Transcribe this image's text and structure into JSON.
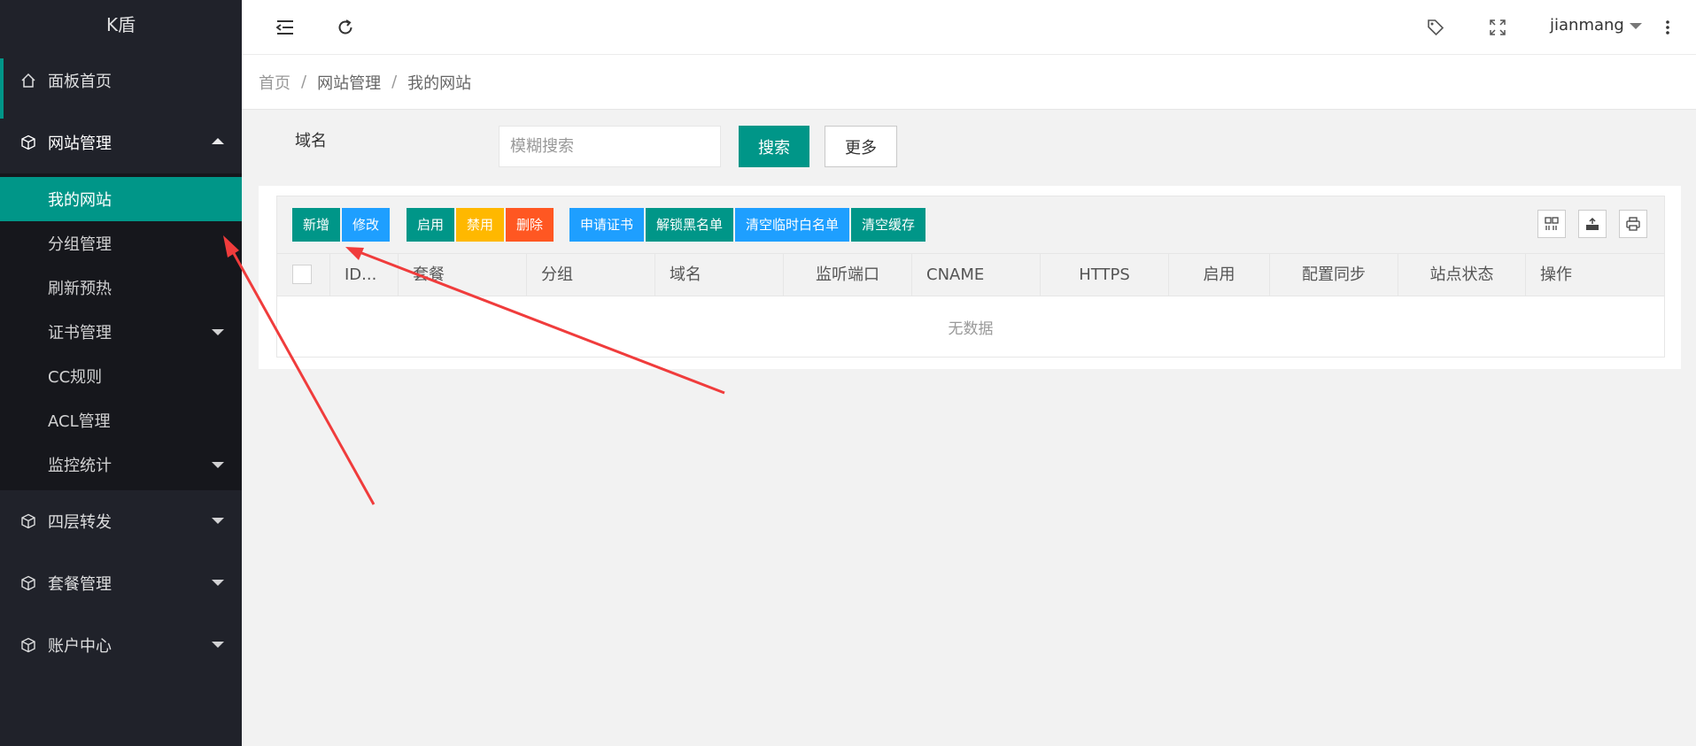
{
  "app": {
    "logo": "K盾"
  },
  "sidebar": {
    "home": {
      "label": "面板首页",
      "icon": "home-icon"
    },
    "site_mgmt": {
      "label": "网站管理",
      "icon": "cube-icon"
    },
    "site_sub": [
      {
        "label": "我的网站"
      },
      {
        "label": "分组管理"
      },
      {
        "label": "刷新预热"
      },
      {
        "label": "证书管理"
      },
      {
        "label": "CC规则"
      },
      {
        "label": "ACL管理"
      },
      {
        "label": "监控统计"
      }
    ],
    "layer4": {
      "label": "四层转发",
      "icon": "cube-icon"
    },
    "packages": {
      "label": "套餐管理",
      "icon": "cube-icon"
    },
    "account": {
      "label": "账户中心",
      "icon": "cube-icon"
    }
  },
  "header": {
    "user": "jianmang",
    "icons": [
      "menu-fold-icon",
      "refresh-icon",
      "tag-icon",
      "fullscreen-icon",
      "more-vertical-icon"
    ]
  },
  "breadcrumb": {
    "items": [
      "首页",
      "网站管理",
      "我的网站"
    ],
    "separator": "/"
  },
  "search": {
    "label": "域名",
    "placeholder": "模糊搜索",
    "value": "",
    "search_label": "搜索",
    "more_label": "更多"
  },
  "toolbar": {
    "add": "新增",
    "edit": "修改",
    "enable": "启用",
    "disable": "禁用",
    "delete": "删除",
    "apply_cert": "申请证书",
    "unlock_blacklist": "解锁黑名单",
    "clear_temp_whitelist": "清空临时白名单",
    "clear_cache": "清空缓存",
    "right_icons": [
      "columns-icon",
      "export-icon",
      "print-icon"
    ]
  },
  "table": {
    "columns": [
      "ID...",
      "套餐",
      "分组",
      "域名",
      "监听端口",
      "CNAME",
      "HTTPS",
      "启用",
      "配置同步",
      "站点状态",
      "操作"
    ],
    "empty_text": "无数据"
  },
  "colors": {
    "primary": "#009688",
    "blue": "#1e9fff",
    "orange": "#ffb800",
    "red": "#ff5722",
    "sidebar": "#20222a",
    "annotation": "#f03c3c"
  }
}
